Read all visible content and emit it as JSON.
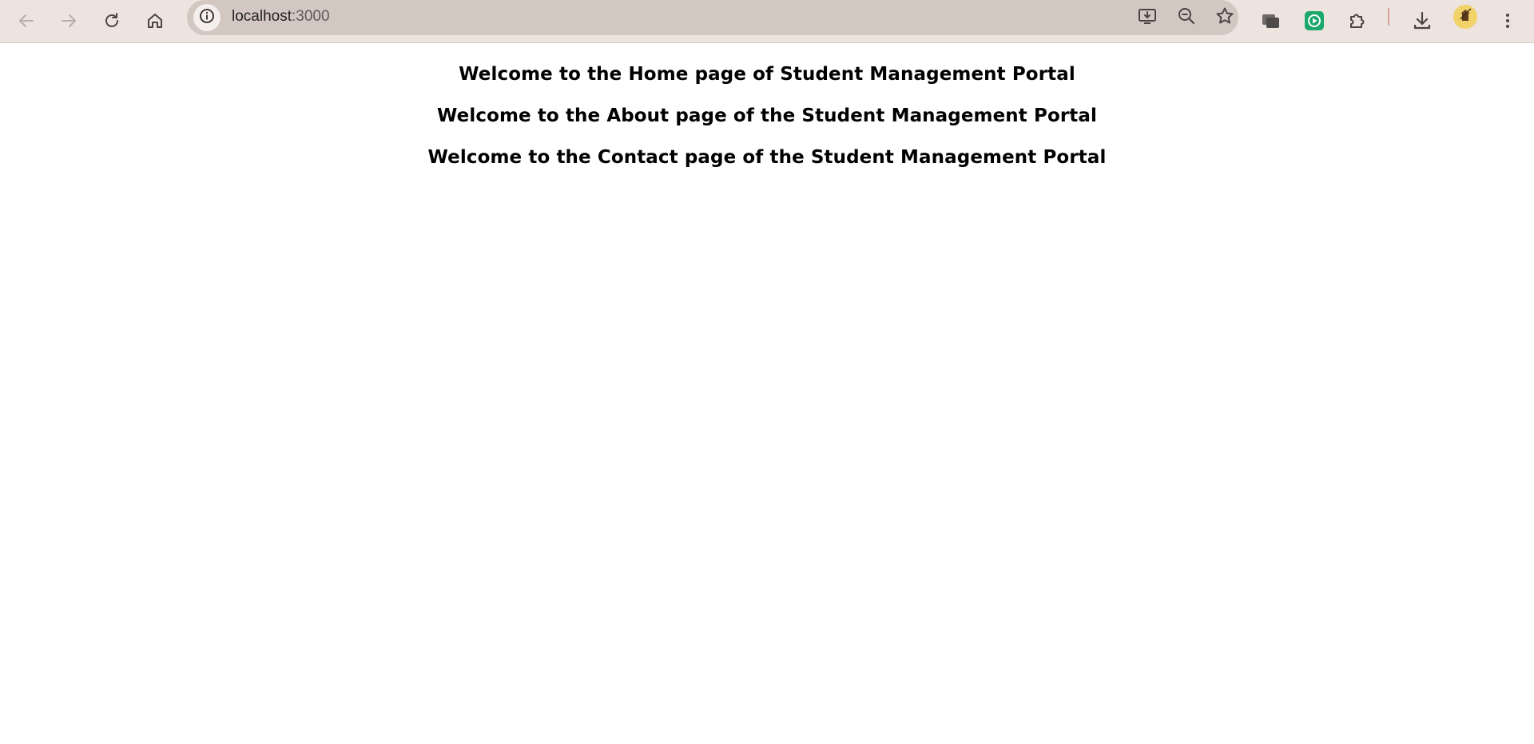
{
  "browser": {
    "url": {
      "host": "localhost",
      "port": ":3000"
    },
    "colors": {
      "toolbar_bg": "#ede3df",
      "omnibox_bg": "#d3c7c2",
      "extension_green": "#1aa86b",
      "avatar_bg": "#f1d36a"
    },
    "icons": {
      "back": "arrow-left-icon",
      "forward": "arrow-right-icon",
      "reload": "reload-icon",
      "home": "home-icon",
      "site_info": "info-icon",
      "install": "install-app-icon",
      "zoom": "zoom-out-icon",
      "bookmark": "star-icon",
      "ext1": "extension-cards-icon",
      "ext2": "extension-play-icon",
      "extensions": "puzzle-icon",
      "downloads": "download-icon",
      "profile": "avatar",
      "menu": "kebab-menu-icon"
    }
  },
  "page": {
    "headings": [
      "Welcome to the Home page of Student Management Portal",
      "Welcome to the About page of the Student Management Portal",
      "Welcome to the Contact page of the Student Management Portal"
    ]
  }
}
